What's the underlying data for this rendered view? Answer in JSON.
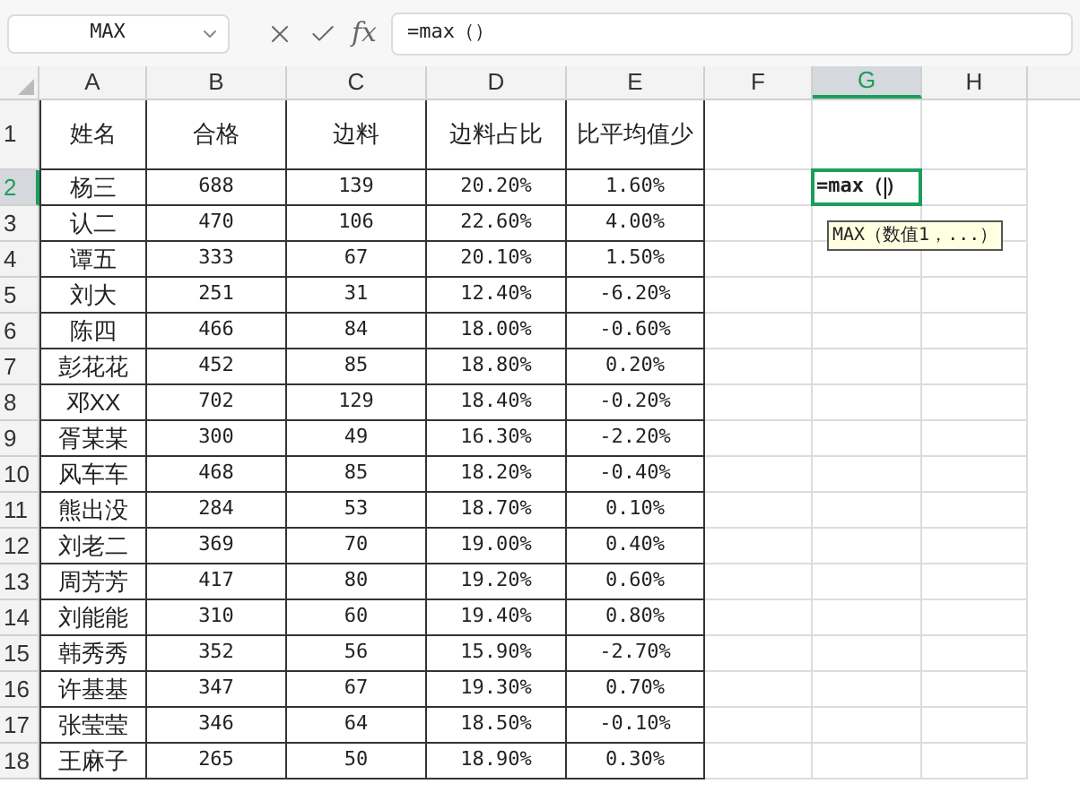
{
  "formula_bar": {
    "name_box": "MAX",
    "function_button": "fx",
    "formula": "=max（）"
  },
  "columns": [
    {
      "label": "A",
      "selected": false
    },
    {
      "label": "B",
      "selected": false
    },
    {
      "label": "C",
      "selected": false
    },
    {
      "label": "D",
      "selected": false
    },
    {
      "label": "E",
      "selected": false
    },
    {
      "label": "F",
      "selected": false
    },
    {
      "label": "G",
      "selected": true
    },
    {
      "label": "H",
      "selected": false
    }
  ],
  "rows": [
    {
      "number": "1",
      "selected": false,
      "cells": [
        "姓名",
        "合格",
        "边料",
        "边料占比",
        "比平均值少"
      ]
    },
    {
      "number": "2",
      "selected": true,
      "cells": [
        "杨三",
        "688",
        "139",
        "20.20%",
        "1.60%"
      ]
    },
    {
      "number": "3",
      "selected": false,
      "cells": [
        "认二",
        "470",
        "106",
        "22.60%",
        "4.00%"
      ]
    },
    {
      "number": "4",
      "selected": false,
      "cells": [
        "谭五",
        "333",
        "67",
        "20.10%",
        "1.50%"
      ]
    },
    {
      "number": "5",
      "selected": false,
      "cells": [
        "刘大",
        "251",
        "31",
        "12.40%",
        "-6.20%"
      ]
    },
    {
      "number": "6",
      "selected": false,
      "cells": [
        "陈四",
        "466",
        "84",
        "18.00%",
        "-0.60%"
      ]
    },
    {
      "number": "7",
      "selected": false,
      "cells": [
        "彭花花",
        "452",
        "85",
        "18.80%",
        "0.20%"
      ]
    },
    {
      "number": "8",
      "selected": false,
      "cells": [
        "邓XX",
        "702",
        "129",
        "18.40%",
        "-0.20%"
      ]
    },
    {
      "number": "9",
      "selected": false,
      "cells": [
        "胥某某",
        "300",
        "49",
        "16.30%",
        "-2.20%"
      ]
    },
    {
      "number": "10",
      "selected": false,
      "cells": [
        "风车车",
        "468",
        "85",
        "18.20%",
        "-0.40%"
      ]
    },
    {
      "number": "11",
      "selected": false,
      "cells": [
        "熊出没",
        "284",
        "53",
        "18.70%",
        "0.10%"
      ]
    },
    {
      "number": "12",
      "selected": false,
      "cells": [
        "刘老二",
        "369",
        "70",
        "19.00%",
        "0.40%"
      ]
    },
    {
      "number": "13",
      "selected": false,
      "cells": [
        "周芳芳",
        "417",
        "80",
        "19.20%",
        "0.60%"
      ]
    },
    {
      "number": "14",
      "selected": false,
      "cells": [
        "刘能能",
        "310",
        "60",
        "19.40%",
        "0.80%"
      ]
    },
    {
      "number": "15",
      "selected": false,
      "cells": [
        "韩秀秀",
        "352",
        "56",
        "15.90%",
        "-2.70%"
      ]
    },
    {
      "number": "16",
      "selected": false,
      "cells": [
        "许基基",
        "347",
        "67",
        "19.30%",
        "0.70%"
      ]
    },
    {
      "number": "17",
      "selected": false,
      "cells": [
        "张莹莹",
        "346",
        "64",
        "18.50%",
        "-0.10%"
      ]
    },
    {
      "number": "18",
      "selected": false,
      "cells": [
        "王麻子",
        "265",
        "50",
        "18.90%",
        "0.30%"
      ]
    }
  ],
  "active_cell": {
    "text_before_caret": "=max（",
    "text_after_caret": "）",
    "tooltip": "MAX（数值1，...）"
  }
}
